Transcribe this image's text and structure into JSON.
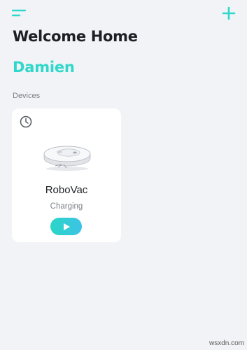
{
  "header": {
    "menu_icon": "menu-icon",
    "add_icon": "plus-icon"
  },
  "greeting": {
    "title": "Welcome Home",
    "user_name": "Damien"
  },
  "devices": {
    "section_label": "Devices",
    "items": [
      {
        "name": "RoboVac",
        "status": "Charging",
        "schedule_icon": "clock-icon",
        "image": "robot-vacuum-image",
        "action_icon": "play-icon"
      }
    ]
  },
  "watermark": "wsxdn.com",
  "colors": {
    "accent": "#2fd8ca",
    "background": "#f2f3f6",
    "card": "#ffffff",
    "text_primary": "#1d1f24"
  }
}
